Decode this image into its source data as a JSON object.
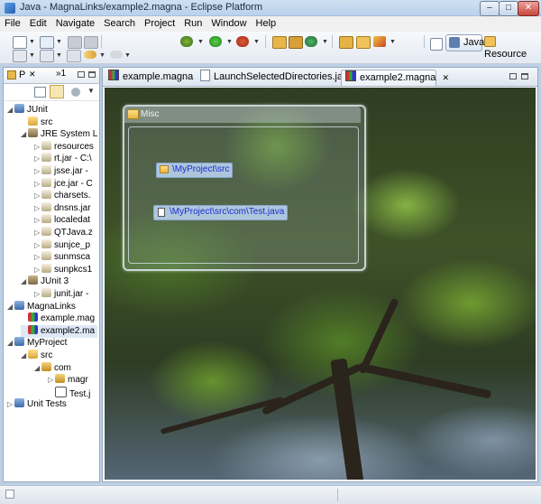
{
  "window": {
    "title": "Java - MagnaLinks/example2.magna - Eclipse Platform",
    "controls": {
      "minimize": "–",
      "maximize": "□",
      "close": "✕"
    }
  },
  "menu": [
    "File",
    "Edit",
    "Navigate",
    "Search",
    "Project",
    "Run",
    "Window",
    "Help"
  ],
  "perspectives": {
    "java": "Java",
    "resource": "Resource"
  },
  "package_explorer": {
    "tab_label": "P",
    "tab_close": "✕",
    "overflow_label": "»1",
    "rows": [
      {
        "label": "JUnit",
        "indent": 0,
        "icon": "project-icon"
      },
      {
        "label": "src",
        "indent": 1,
        "icon": "src-folder-icon"
      },
      {
        "label": "JRE System L",
        "indent": 1,
        "icon": "library-icon"
      },
      {
        "label": "resources",
        "indent": 2,
        "icon": "jar-icon"
      },
      {
        "label": "rt.jar - C:\\",
        "indent": 2,
        "icon": "jar-icon"
      },
      {
        "label": "jsse.jar -",
        "indent": 2,
        "icon": "jar-icon"
      },
      {
        "label": "jce.jar - C",
        "indent": 2,
        "icon": "jar-icon"
      },
      {
        "label": "charsets.",
        "indent": 2,
        "icon": "jar-icon"
      },
      {
        "label": "dnsns.jar",
        "indent": 2,
        "icon": "jar-icon"
      },
      {
        "label": "localedat",
        "indent": 2,
        "icon": "jar-icon"
      },
      {
        "label": "QTJava.z",
        "indent": 2,
        "icon": "jar-icon"
      },
      {
        "label": "sunjce_p",
        "indent": 2,
        "icon": "jar-icon"
      },
      {
        "label": "sunmsca",
        "indent": 2,
        "icon": "jar-icon"
      },
      {
        "label": "sunpkcs1",
        "indent": 2,
        "icon": "jar-icon"
      },
      {
        "label": "JUnit 3",
        "indent": 1,
        "icon": "library-icon"
      },
      {
        "label": "junit.jar -",
        "indent": 2,
        "icon": "jar-icon"
      },
      {
        "label": "MagnaLinks",
        "indent": 0,
        "icon": "project-icon"
      },
      {
        "label": "example.mag",
        "indent": 1,
        "icon": "magna-file-icon"
      },
      {
        "label": "example2.ma",
        "indent": 1,
        "icon": "magna-file-icon"
      },
      {
        "label": "MyProject",
        "indent": 0,
        "icon": "project-icon"
      },
      {
        "label": "src",
        "indent": 1,
        "icon": "src-folder-icon"
      },
      {
        "label": "com",
        "indent": 2,
        "icon": "package-icon"
      },
      {
        "label": "magr",
        "indent": 3,
        "icon": "package-icon"
      },
      {
        "label": "Test.j",
        "indent": 3,
        "icon": "java-file-icon"
      },
      {
        "label": "Unit Tests",
        "indent": 0,
        "icon": "project-icon"
      }
    ]
  },
  "editor": {
    "tabs": [
      {
        "label": "example.magna",
        "icon": "magna-file-icon",
        "active": false
      },
      {
        "label": "LaunchSelectedDirectories.java",
        "icon": "java-file-icon",
        "active": false
      },
      {
        "label": "example2.magna",
        "icon": "magna-file-icon",
        "active": true,
        "close": "✕"
      }
    ],
    "group": {
      "title": "Misc",
      "links": [
        {
          "label": "\\MyProject\\src",
          "icon": "folder-icon"
        },
        {
          "label": "\\MyProject\\src\\com\\Test.java",
          "icon": "java-file-icon"
        }
      ]
    }
  }
}
